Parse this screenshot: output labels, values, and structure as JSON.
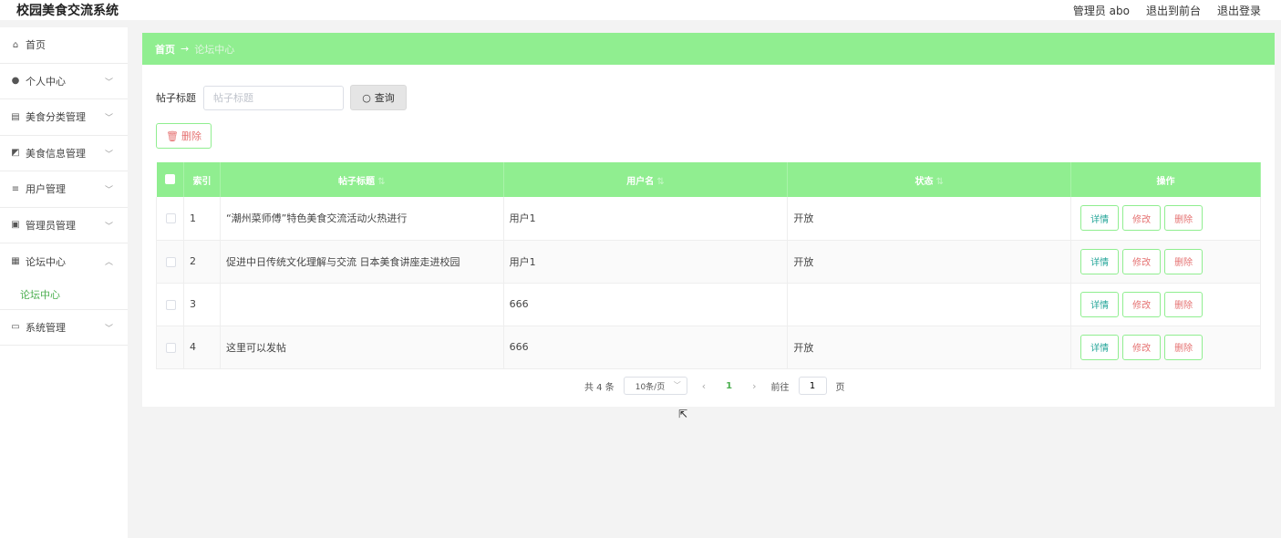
{
  "header": {
    "app_title": "校园美食交流系统",
    "user_label": "管理员 abo",
    "front_link": "退出到前台",
    "logout_link": "退出登录"
  },
  "sidebar": {
    "items": [
      {
        "label": "首页",
        "icon": "home-icon",
        "glyph": "⌂"
      },
      {
        "label": "个人中心",
        "icon": "user-icon",
        "glyph": "●"
      },
      {
        "label": "美食分类管理",
        "icon": "bag-icon",
        "glyph": "▤"
      },
      {
        "label": "美食信息管理",
        "icon": "wallet-icon",
        "glyph": "◩"
      },
      {
        "label": "用户管理",
        "icon": "menu-icon",
        "glyph": "≡"
      },
      {
        "label": "管理员管理",
        "icon": "notebook-icon",
        "glyph": "▣"
      },
      {
        "label": "论坛中心",
        "icon": "clipboard-icon",
        "glyph": "▦"
      },
      {
        "label": "系统管理",
        "icon": "screen-icon",
        "glyph": "▭"
      }
    ],
    "submenu_label": "论坛中心"
  },
  "breadcrumb": {
    "home": "首页",
    "arrow": "→",
    "current": "论坛中心"
  },
  "search": {
    "label": "帖子标题",
    "placeholder": "帖子标题",
    "button": "查询"
  },
  "toolbar": {
    "delete_label": "删除"
  },
  "table": {
    "headers": {
      "index": "索引",
      "title": "帖子标题",
      "username": "用户名",
      "status": "状态",
      "actions": "操作"
    },
    "rows": [
      {
        "index": "1",
        "title": "“潮州菜师傅”特色美食交流活动火热进行",
        "username": "用户1",
        "status": "开放"
      },
      {
        "index": "2",
        "title": "促进中日传统文化理解与交流 日本美食讲座走进校园",
        "username": "用户1",
        "status": "开放"
      },
      {
        "index": "3",
        "title": "",
        "username": "666",
        "status": ""
      },
      {
        "index": "4",
        "title": "这里可以发帖",
        "username": "666",
        "status": "开放"
      }
    ],
    "action_labels": {
      "detail": "详情",
      "edit": "修改",
      "delete": "删除"
    }
  },
  "pagination": {
    "total": "共 4 条",
    "page_size": "10条/页",
    "current_page": "1",
    "goto_label": "前往",
    "goto_value": "1",
    "page_unit": "页"
  },
  "colors": {
    "accent_green": "#90ee90",
    "danger_red": "#e57373",
    "detail_teal": "#26a69a"
  }
}
